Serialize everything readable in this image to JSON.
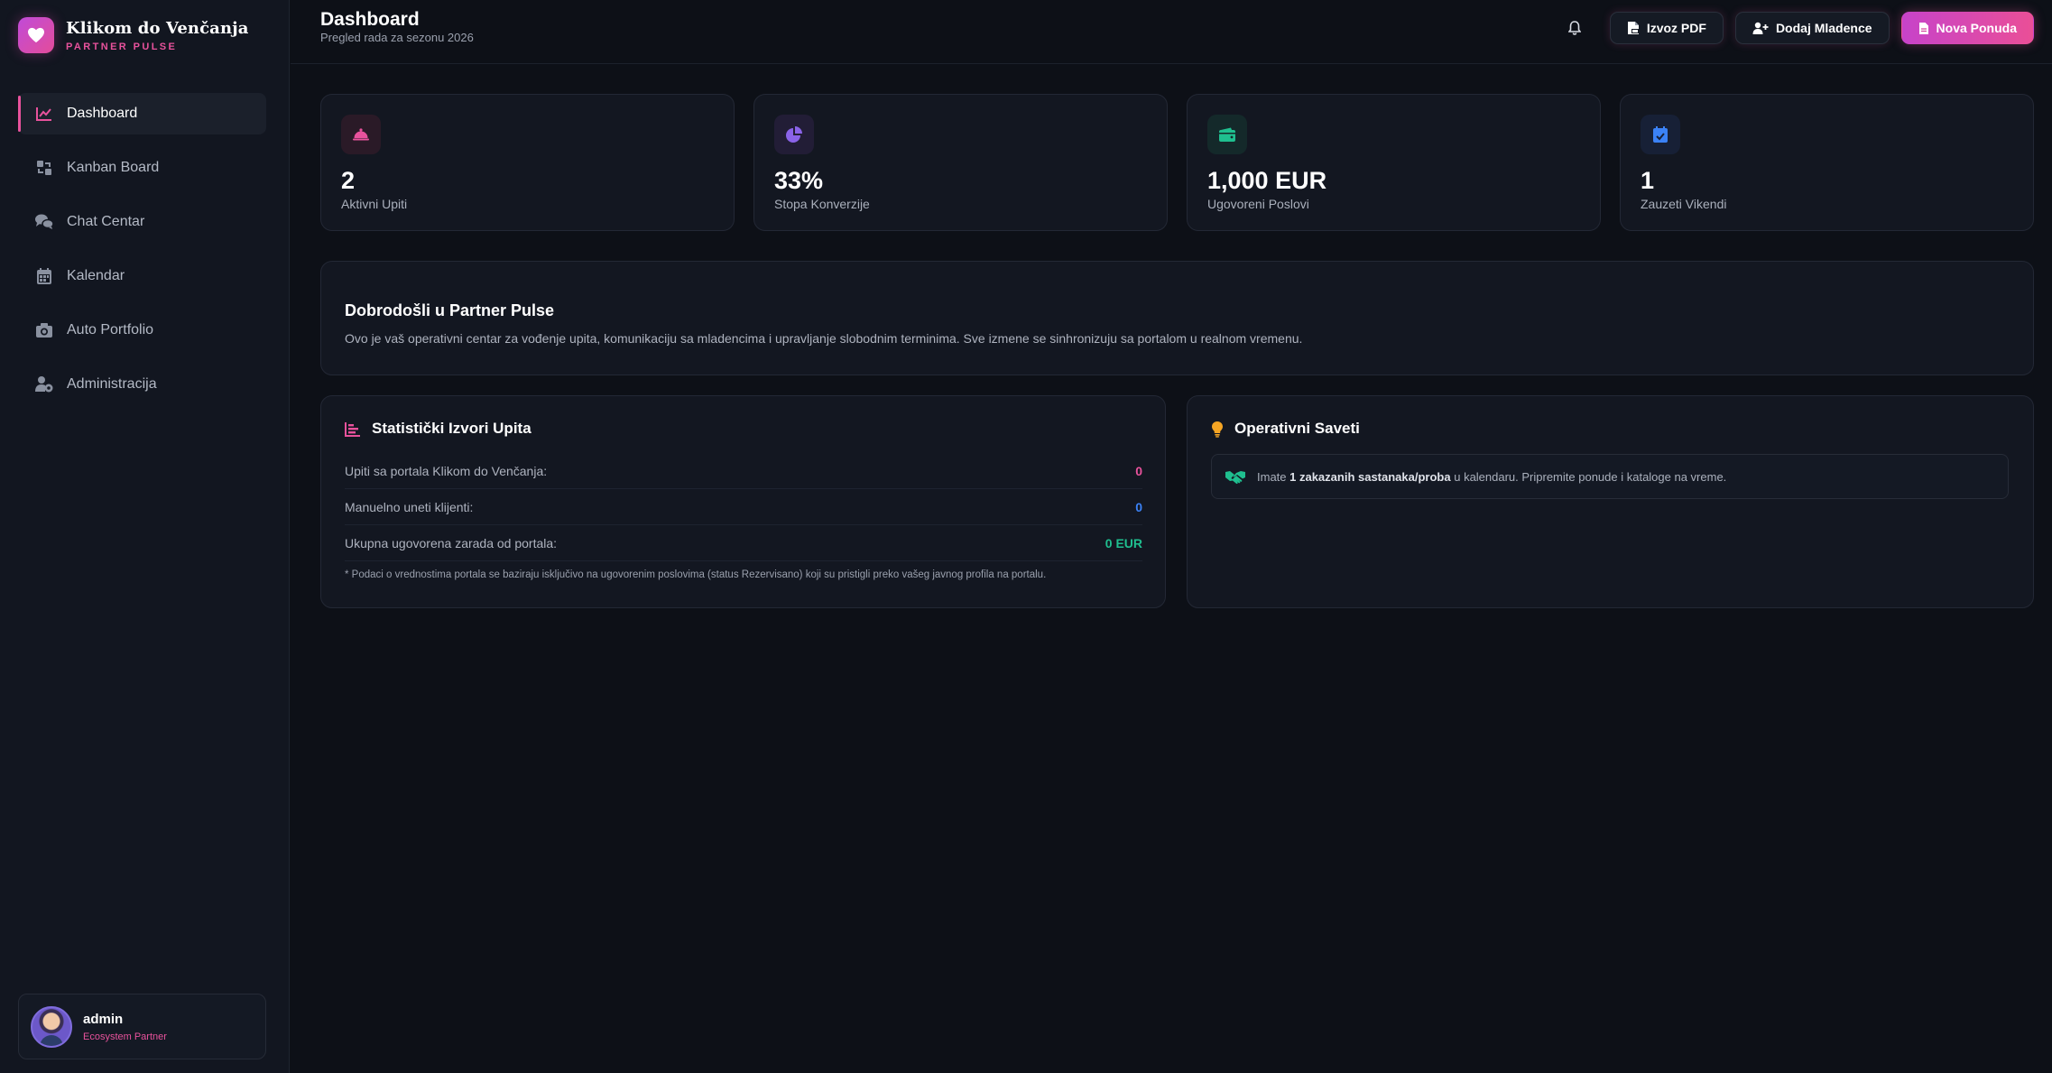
{
  "brand": {
    "title": "Klikom do Venčanja",
    "subtitle": "PARTNER PULSE",
    "icon": "heart-icon"
  },
  "nav": [
    {
      "label": "Dashboard",
      "icon": "chart-line-icon",
      "active": true
    },
    {
      "label": "Kanban Board",
      "icon": "kanban-icon"
    },
    {
      "label": "Chat Centar",
      "icon": "chat-icon"
    },
    {
      "label": "Kalendar",
      "icon": "calendar-icon"
    },
    {
      "label": "Auto Portfolio",
      "icon": "camera-icon"
    },
    {
      "label": "Administracija",
      "icon": "user-gear-icon"
    }
  ],
  "user": {
    "name": "admin",
    "role": "Ecosystem Partner"
  },
  "header": {
    "title": "Dashboard",
    "subtitle": "Pregled rada za sezonu 2026",
    "buttons": {
      "export": "Izvoz PDF",
      "add": "Dodaj Mladence",
      "new": "Nova Ponuda"
    }
  },
  "stats": [
    {
      "value": "2",
      "label": "Aktivni Upiti",
      "icon": "bell-service-icon",
      "color": "#e8529c"
    },
    {
      "value": "33%",
      "label": "Stopa Konverzije",
      "icon": "pie-chart-icon",
      "color": "#8a63e8"
    },
    {
      "value": "1,000 EUR",
      "label": "Ugovoreni Poslovi",
      "icon": "wallet-icon",
      "color": "#1fbf8f"
    },
    {
      "value": "1",
      "label": "Zauzeti Vikendi",
      "icon": "calendar-check-icon",
      "color": "#3b82f6"
    }
  ],
  "welcome": {
    "title": "Dobrodošli u Partner Pulse",
    "text": "Ovo je vaš operativni centar za vođenje upita, komunikaciju sa mladencima i upravljanje slobodnim terminima. Sve izmene se sinhronizuju sa portalom u realnom vremenu."
  },
  "sources": {
    "title": "Statistički Izvori Upita",
    "rows": [
      {
        "label": "Upiti sa portala Klikom do Venčanja:",
        "value": "0",
        "color": "#e8529c"
      },
      {
        "label": "Manuelno uneti klijenti:",
        "value": "0",
        "color": "#3b82f6"
      },
      {
        "label": "Ukupna ugovorena zarada od portala:",
        "value": "0 EUR",
        "color": "#1fbf8f"
      }
    ],
    "footnote": "* Podaci o vrednostima portala se baziraju isključivo na ugovorenim poslovima (status Rezervisano) koji su pristigli preko vašeg javnog profila na portalu."
  },
  "tips": {
    "title": "Operativni Saveti",
    "tip_prefix": "Imate ",
    "tip_bold": "1 zakazanih sastanaka/proba",
    "tip_suffix": " u kalendaru. Pripremite ponude i kataloge na vreme."
  }
}
